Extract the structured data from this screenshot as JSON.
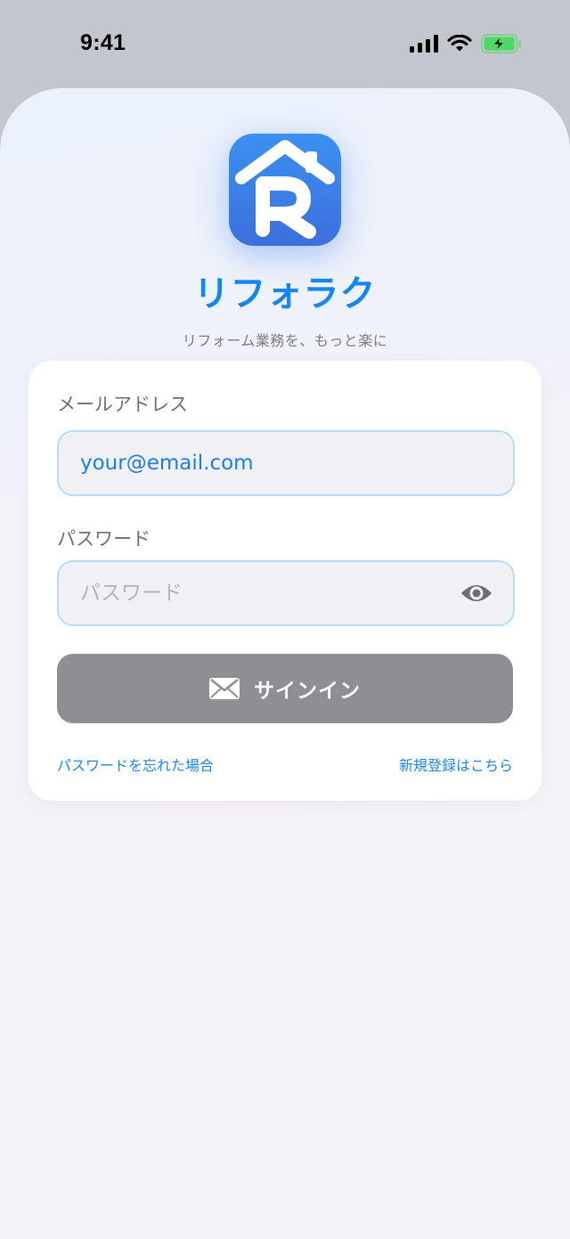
{
  "status_bar": {
    "time": "9:41"
  },
  "app": {
    "name": "リフォラク",
    "tagline": "リフォーム業務を、もっと楽に"
  },
  "login_form": {
    "email_label": "メールアドレス",
    "email_value": "your@email.com",
    "password_label": "パスワード",
    "password_placeholder": "パスワード",
    "signin_label": "サインイン",
    "forgot_password_link": "パスワードを忘れた場合",
    "register_link": "新規登録はこちら"
  },
  "colors": {
    "accent": "#1486f0",
    "button_disabled": "#8e8e93",
    "input_border": "#b8dcf6",
    "battery_green": "#4cd964"
  },
  "icons": [
    "cellular-signal-icon",
    "wifi-icon",
    "battery-charging-icon",
    "app-logo-icon",
    "eye-icon",
    "envelope-icon"
  ]
}
